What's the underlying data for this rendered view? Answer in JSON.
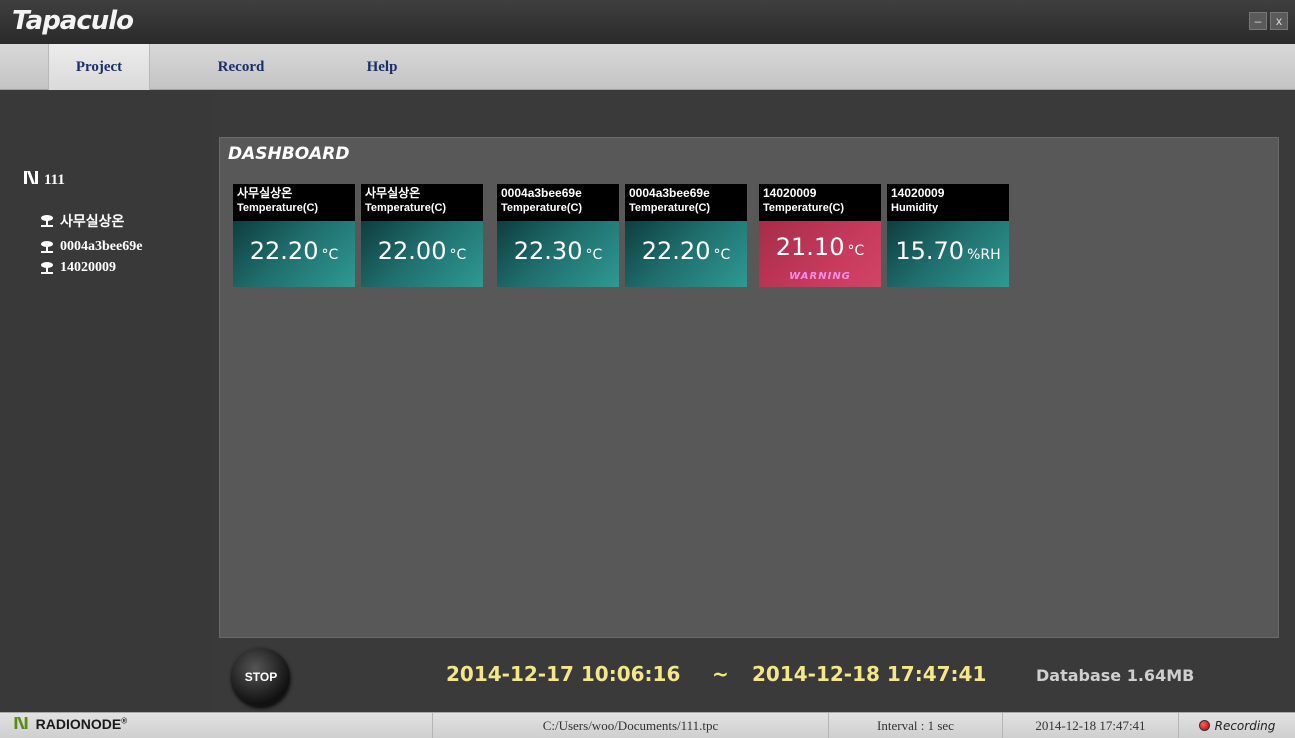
{
  "app": {
    "title": "Tapaculo",
    "minimize_glyph": "–",
    "close_glyph": "x"
  },
  "menu": {
    "items": [
      {
        "label": "Project",
        "active": true
      },
      {
        "label": "Record",
        "active": false
      },
      {
        "label": "Help",
        "active": false
      }
    ]
  },
  "sidebar": {
    "project_name": "111",
    "project_icon": "project-network-icon",
    "nodes": [
      {
        "label": "사무실상온",
        "icon": "sensor-node-icon"
      },
      {
        "label": "0004a3bee69e",
        "icon": "sensor-node-icon"
      },
      {
        "label": "14020009",
        "icon": "sensor-node-icon"
      }
    ]
  },
  "dashboard": {
    "title": "DASHBOARD",
    "tiles": [
      {
        "name": "사무실상온",
        "measure": "Temperature(C)",
        "value": "22.20",
        "unit": "°C",
        "warning": ""
      },
      {
        "name": "사무실상온",
        "measure": "Temperature(C)",
        "value": "22.00",
        "unit": "°C",
        "warning": ""
      },
      {
        "name": "0004a3bee69e",
        "measure": "Temperature(C)",
        "value": "22.30",
        "unit": "°C",
        "warning": ""
      },
      {
        "name": "0004a3bee69e",
        "measure": "Temperature(C)",
        "value": "22.20",
        "unit": "°C",
        "warning": ""
      },
      {
        "name": "14020009",
        "measure": "Temperature(C)",
        "value": "21.10",
        "unit": "°C",
        "warning": "WARNING"
      },
      {
        "name": "14020009",
        "measure": "Humidity",
        "value": "15.70",
        "unit": "%RH",
        "warning": ""
      }
    ],
    "colors": {
      "normal": "#1f6d6c",
      "warning": "#c63a5c"
    }
  },
  "controls": {
    "stop_label": "STOP",
    "range_start": "2014-12-17 10:06:16",
    "range_separator": "~",
    "range_end": "2014-12-18 17:47:41",
    "database_size": "Database 1.64MB"
  },
  "statusbar": {
    "brand": "RADIONODE",
    "brand_mark": "®",
    "file_path": "C:/Users/woo/Documents/111.tpc",
    "interval": "Interval : 1 sec",
    "timestamp": "2014-12-18 17:47:41",
    "recording_label": "Recording"
  }
}
